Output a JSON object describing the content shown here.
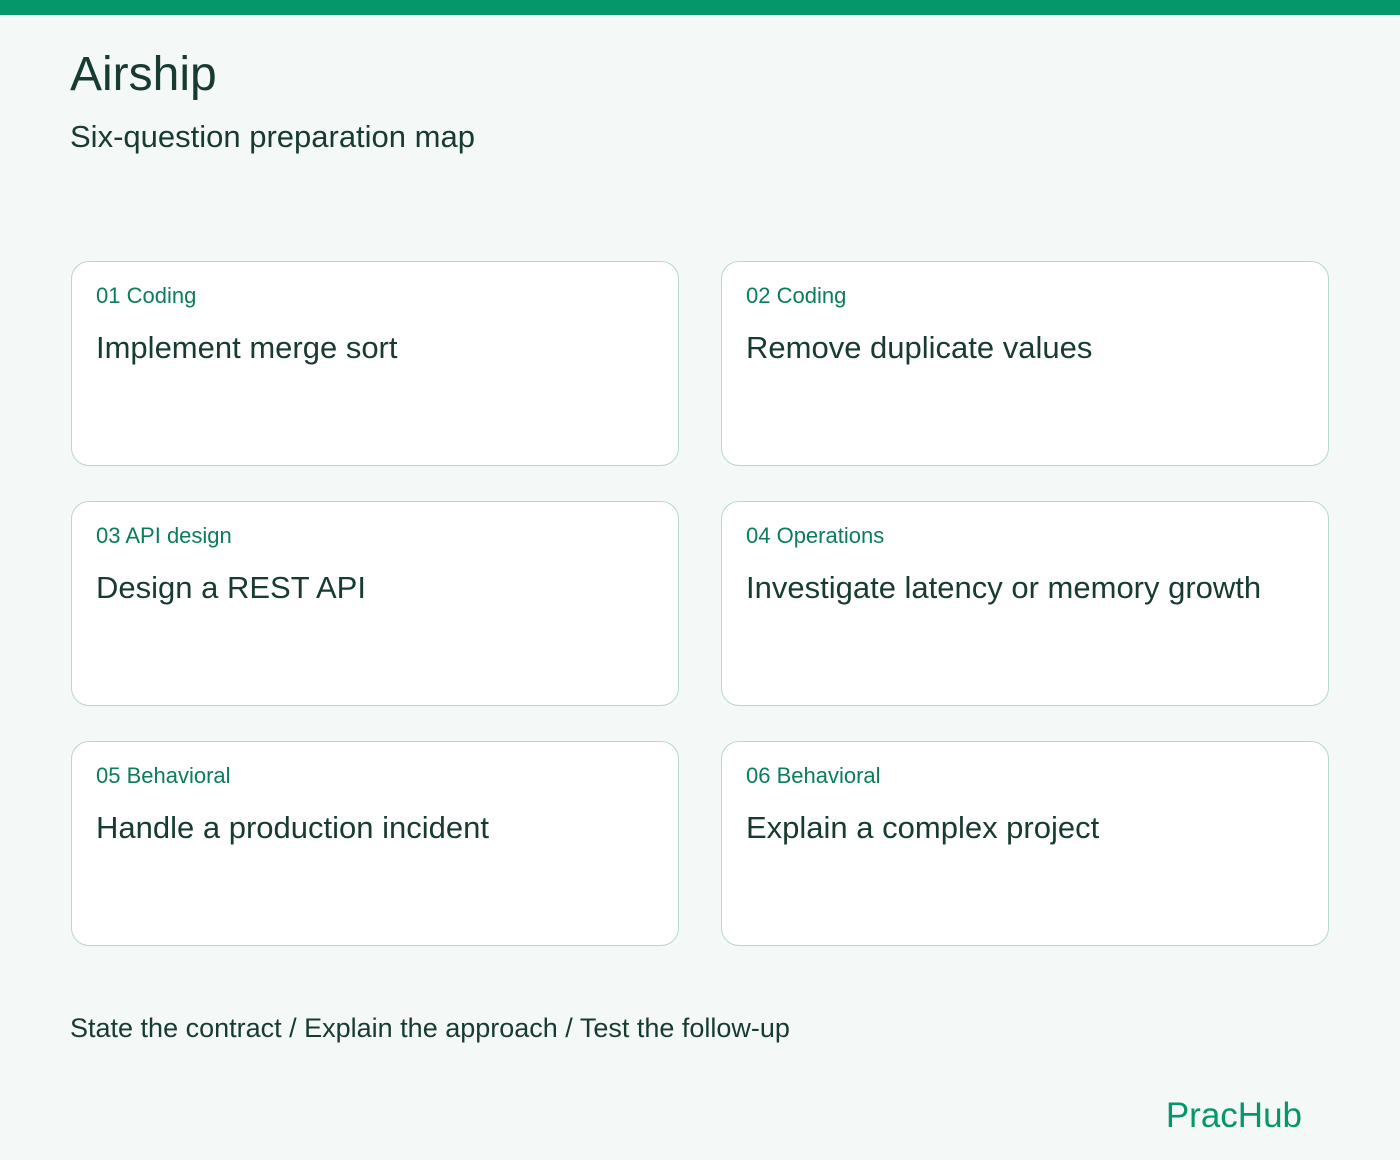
{
  "header": {
    "title": "Airship",
    "subtitle": "Six-question preparation map"
  },
  "cards": [
    {
      "tag": "01 Coding",
      "title": "Implement merge sort"
    },
    {
      "tag": "02 Coding",
      "title": "Remove duplicate values"
    },
    {
      "tag": "03 API design",
      "title": "Design a REST API"
    },
    {
      "tag": "04 Operations",
      "title": "Investigate latency or memory growth"
    },
    {
      "tag": "05 Behavioral",
      "title": "Handle a production incident"
    },
    {
      "tag": "06 Behavioral",
      "title": "Explain a complex project"
    }
  ],
  "footer": {
    "note": "State the contract / Explain the approach / Test the follow-up",
    "brand": "PracHub"
  },
  "colors": {
    "accent": "#05966a",
    "tag_text": "#0a7d5c",
    "card_border": "#b6d8cc",
    "background": "#f4f8f6",
    "text": "#173b32"
  }
}
